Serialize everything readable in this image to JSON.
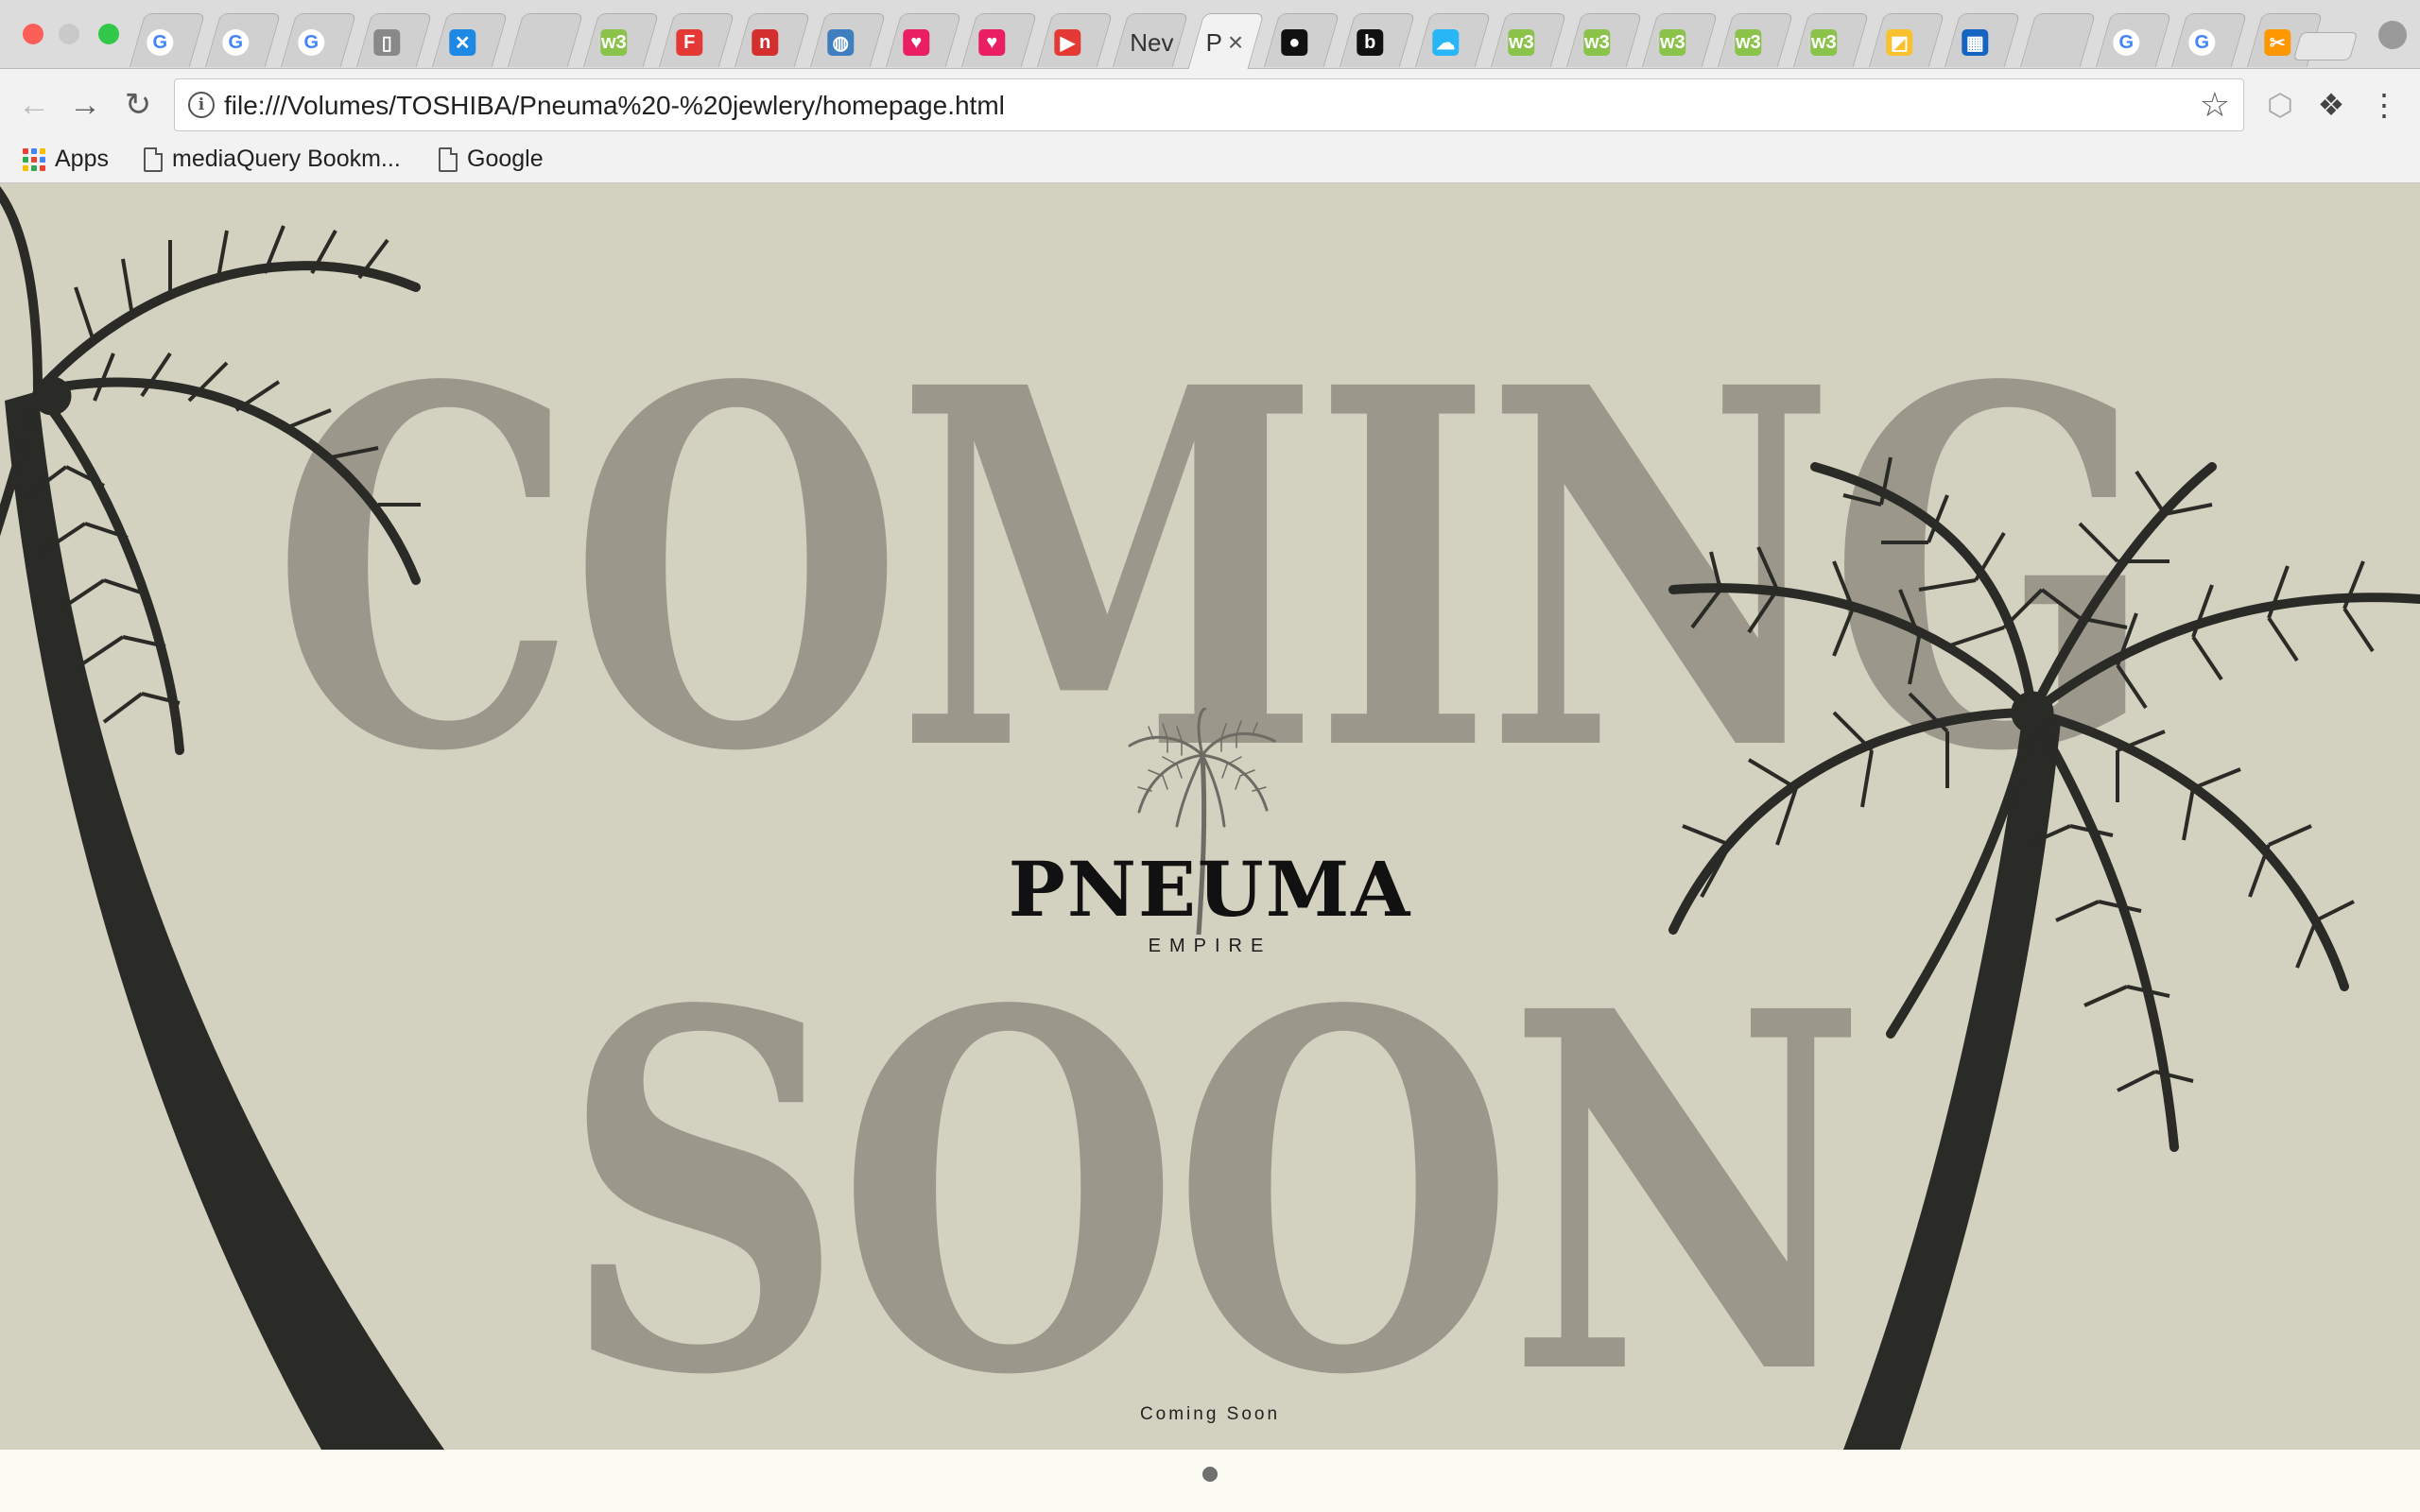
{
  "browser": {
    "tabs": [
      {
        "favicon": "google-icon",
        "color": "#4285f4",
        "glyph": "G"
      },
      {
        "favicon": "google-icon",
        "color": "#4285f4",
        "glyph": "G"
      },
      {
        "favicon": "google-icon",
        "color": "#4285f4",
        "glyph": "G"
      },
      {
        "favicon": "document-icon",
        "color": "#888888",
        "glyph": "▯"
      },
      {
        "favicon": "cross-x-icon",
        "color": "#1e88e5",
        "glyph": "✕"
      },
      {
        "favicon": "blank-icon",
        "color": "#d0d0d0",
        "glyph": ""
      },
      {
        "favicon": "w3-icon",
        "color": "#8bc34a",
        "glyph": "w3"
      },
      {
        "favicon": "f-icon",
        "color": "#e53935",
        "glyph": "F"
      },
      {
        "favicon": "red-square-icon",
        "color": "#d32f2f",
        "glyph": "n"
      },
      {
        "favicon": "globe-icon",
        "color": "#3f7fbf",
        "glyph": "◍"
      },
      {
        "favicon": "heart-icon",
        "color": "#e91e63",
        "glyph": "♥"
      },
      {
        "favicon": "heart-icon",
        "color": "#e91e63",
        "glyph": "♥"
      },
      {
        "favicon": "youtube-icon",
        "color": "#e53935",
        "glyph": "▶"
      },
      {
        "favicon": "text-tab",
        "color": "#d0d0d0",
        "glyph": "Nev"
      },
      {
        "favicon": "active-tab",
        "color": "#f2f2f2",
        "glyph": "P",
        "active": true
      },
      {
        "favicon": "circle-logo-icon",
        "color": "#111111",
        "glyph": "●"
      },
      {
        "favicon": "b-icon",
        "color": "#111111",
        "glyph": "b"
      },
      {
        "favicon": "cloud-icon",
        "color": "#29b6f6",
        "glyph": "☁"
      },
      {
        "favicon": "w3-icon",
        "color": "#8bc34a",
        "glyph": "w3"
      },
      {
        "favicon": "w3-icon",
        "color": "#8bc34a",
        "glyph": "w3"
      },
      {
        "favicon": "w3-icon",
        "color": "#8bc34a",
        "glyph": "w3"
      },
      {
        "favicon": "w3-icon",
        "color": "#8bc34a",
        "glyph": "w3"
      },
      {
        "favicon": "w3-icon",
        "color": "#8bc34a",
        "glyph": "w3"
      },
      {
        "favicon": "note-icon",
        "color": "#fbc02d",
        "glyph": "◩"
      },
      {
        "favicon": "grid-icon",
        "color": "#1565c0",
        "glyph": "▦"
      },
      {
        "favicon": "blank-icon",
        "color": "#d0d0d0",
        "glyph": ""
      },
      {
        "favicon": "google-icon",
        "color": "#4285f4",
        "glyph": "G"
      },
      {
        "favicon": "google-icon",
        "color": "#4285f4",
        "glyph": "G"
      },
      {
        "favicon": "scissors-icon",
        "color": "#ff9800",
        "glyph": "✂"
      }
    ],
    "url": "file:///Volumes/TOSHIBA/Pneuma%20-%20jewlery/homepage.html",
    "bookmarks": {
      "apps": "Apps",
      "item1": "mediaQuery Bookm...",
      "item2": "Google"
    }
  },
  "page": {
    "headline_top": "COMING",
    "headline_bottom": "SOON",
    "brand": "PNEUMA",
    "brand_sub": "EMPIRE",
    "footer": "Coming Soon"
  },
  "colors": {
    "background": "#d3d1bf",
    "headline": "#9b988b",
    "palm": "#2a2a26"
  }
}
